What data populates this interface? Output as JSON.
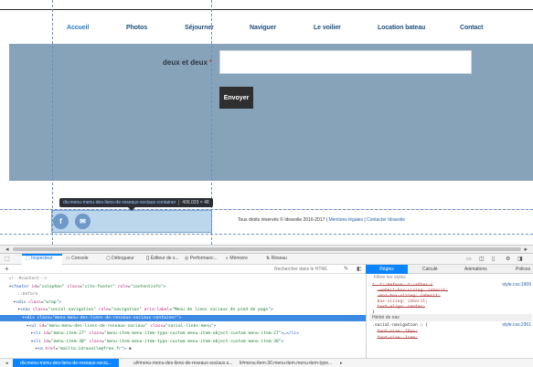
{
  "nav": [
    "Accueil",
    "Photos",
    "Séjourner",
    "Naviguer",
    "Le voilier",
    "Location bateau",
    "Contact"
  ],
  "form": {
    "label": "deux et deux",
    "required_mark": "*",
    "input_value": "",
    "send_label": "Envoyer"
  },
  "tooltip": {
    "selector": "div.menu-menu-des-liens-de-reseaux-sociaux-container",
    "dims": "406.033 × 48"
  },
  "footer": {
    "social": [
      "f",
      "✉"
    ],
    "copyright": "Tous droits réservés © Idravoile 2016-2017 |",
    "link1": " Mentions légales",
    "sep": " | ",
    "link2": "Contacter Idravoile"
  },
  "devtools": {
    "tabs": [
      "Inspecteur",
      "Console",
      "Débogueur",
      "Éditeur de s...",
      "Performanc...",
      "Mémoire",
      "Réseau"
    ],
    "search_placeholder": "Rechercher dans le HTML",
    "rules_tabs": [
      "Règles",
      "Calculé",
      "Animations",
      "Polices"
    ],
    "filter_placeholder": "Filtrer les styles",
    "dom_lines": [
      {
        "indent": 4,
        "html": "<span class='t-cm'>&lt;!--#content--&gt;</span>"
      },
      {
        "indent": 4,
        "html": "▾<span class='t-tag'>&lt;footer</span> <span class='t-attr'>id</span>=<span class='t-val'>\"colophon\"</span> <span class='t-attr'>class</span>=<span class='t-val'>\"site-footer\"</span> <span class='t-attr'>role</span>=<span class='t-val'>\"contentinfo\"</span><span class='t-tag'>&gt;</span>"
      },
      {
        "indent": 8,
        "html": "<span class='t-pseudo'>::before</span>"
      },
      {
        "indent": 6,
        "html": "▾<span class='t-tag'>&lt;div</span> <span class='t-attr'>class</span>=<span class='t-val'>\"wrap\"</span><span class='t-tag'>&gt;</span>"
      },
      {
        "indent": 8,
        "html": "▾<span class='t-tag'>&lt;nav</span> <span class='t-attr'>class</span>=<span class='t-val'>\"social-navigation\"</span> <span class='t-attr'>role</span>=<span class='t-val'>\"navigation\"</span> <span class='t-attr'>aria-label</span>=<span class='t-val'>\"Menu de liens sociaux de pied de page\"</span><span class='t-tag'>&gt;</span>"
      },
      {
        "indent": 10,
        "html": "▾<span class='t-tag'>&lt;div</span> <span class='t-attr'>class</span>=<span class='t-val'>\"menu-menu-des-liens-de-reseaux-sociaux-container\"</span><span class='t-tag'>&gt;</span>",
        "selected": true
      },
      {
        "indent": 12,
        "html": "▾<span class='t-tag'>&lt;ul</span> <span class='t-attr'>id</span>=<span class='t-val'>\"menu-menu-des-liens-de-reseaux-sociaux\"</span> <span class='t-attr'>class</span>=<span class='t-val'>\"social-links-menu\"</span><span class='t-tag'>&gt;</span>"
      },
      {
        "indent": 14,
        "html": "▸<span class='t-tag'>&lt;li</span> <span class='t-attr'>id</span>=<span class='t-val'>\"menu-item-27\"</span> <span class='t-attr'>class</span>=<span class='t-val'>\"menu-item menu-item-type-custom menu-item-object-custom menu-item-27\"</span><span class='t-tag'>&gt;</span>…<span class='t-tag'>&lt;/li&gt;</span>"
      },
      {
        "indent": 14,
        "html": "▾<span class='t-tag'>&lt;li</span> <span class='t-attr'>id</span>=<span class='t-val'>\"menu-item-30\"</span> <span class='t-attr'>class</span>=<span class='t-val'>\"menu-item menu-item-type-custom menu-item-object-custom menu-item-30\"</span><span class='t-tag'>&gt;</span>"
      },
      {
        "indent": 16,
        "html": "▾<span class='t-tag'>&lt;a</span> <span class='t-attr'>href</span>=<span class='t-val'>\"mailto:idravoile@free.fr\"</span><span class='t-tag'>&gt;</span> ⊞"
      }
    ],
    "rule_lines": [
      {
        "html": "<span class='strike'>*, *::before, *::after {</span>"
      },
      {
        "html": "&nbsp;&nbsp;<span class='strike'>-webkit-box-sizing: inherit;</span>"
      },
      {
        "html": "&nbsp;&nbsp;<span class='strike'>-moz-box-sizing: inherit;</span>"
      },
      {
        "html": "&nbsp;&nbsp;<span class='prop'>box-sizing: inherit;</span>"
      },
      {
        "html": "&nbsp;&nbsp;<span class='strike'>text-align: center;</span>"
      },
      {
        "html": "}"
      }
    ],
    "inherited_label": "Hérité de nav",
    "rule2_lines": [
      {
        "html": ".social-navigation ◌ {"
      },
      {
        "html": "&nbsp;&nbsp;<span class='strike'>font-size: 16px;</span>"
      },
      {
        "html": "&nbsp;&nbsp;<span class='strike'>font-size: 1rem;</span>"
      }
    ],
    "rule_src1": "style.css:1909",
    "rule_src2": "style.css:2361",
    "breadcrumbs": [
      "div.menu-menu-des-liens-de-reseaux-socia...",
      "ul#menu-menu-des-liens-de-reseaux-sociaux.s...",
      "li#menu-item-30.menu-item.menu-item-type..."
    ]
  }
}
